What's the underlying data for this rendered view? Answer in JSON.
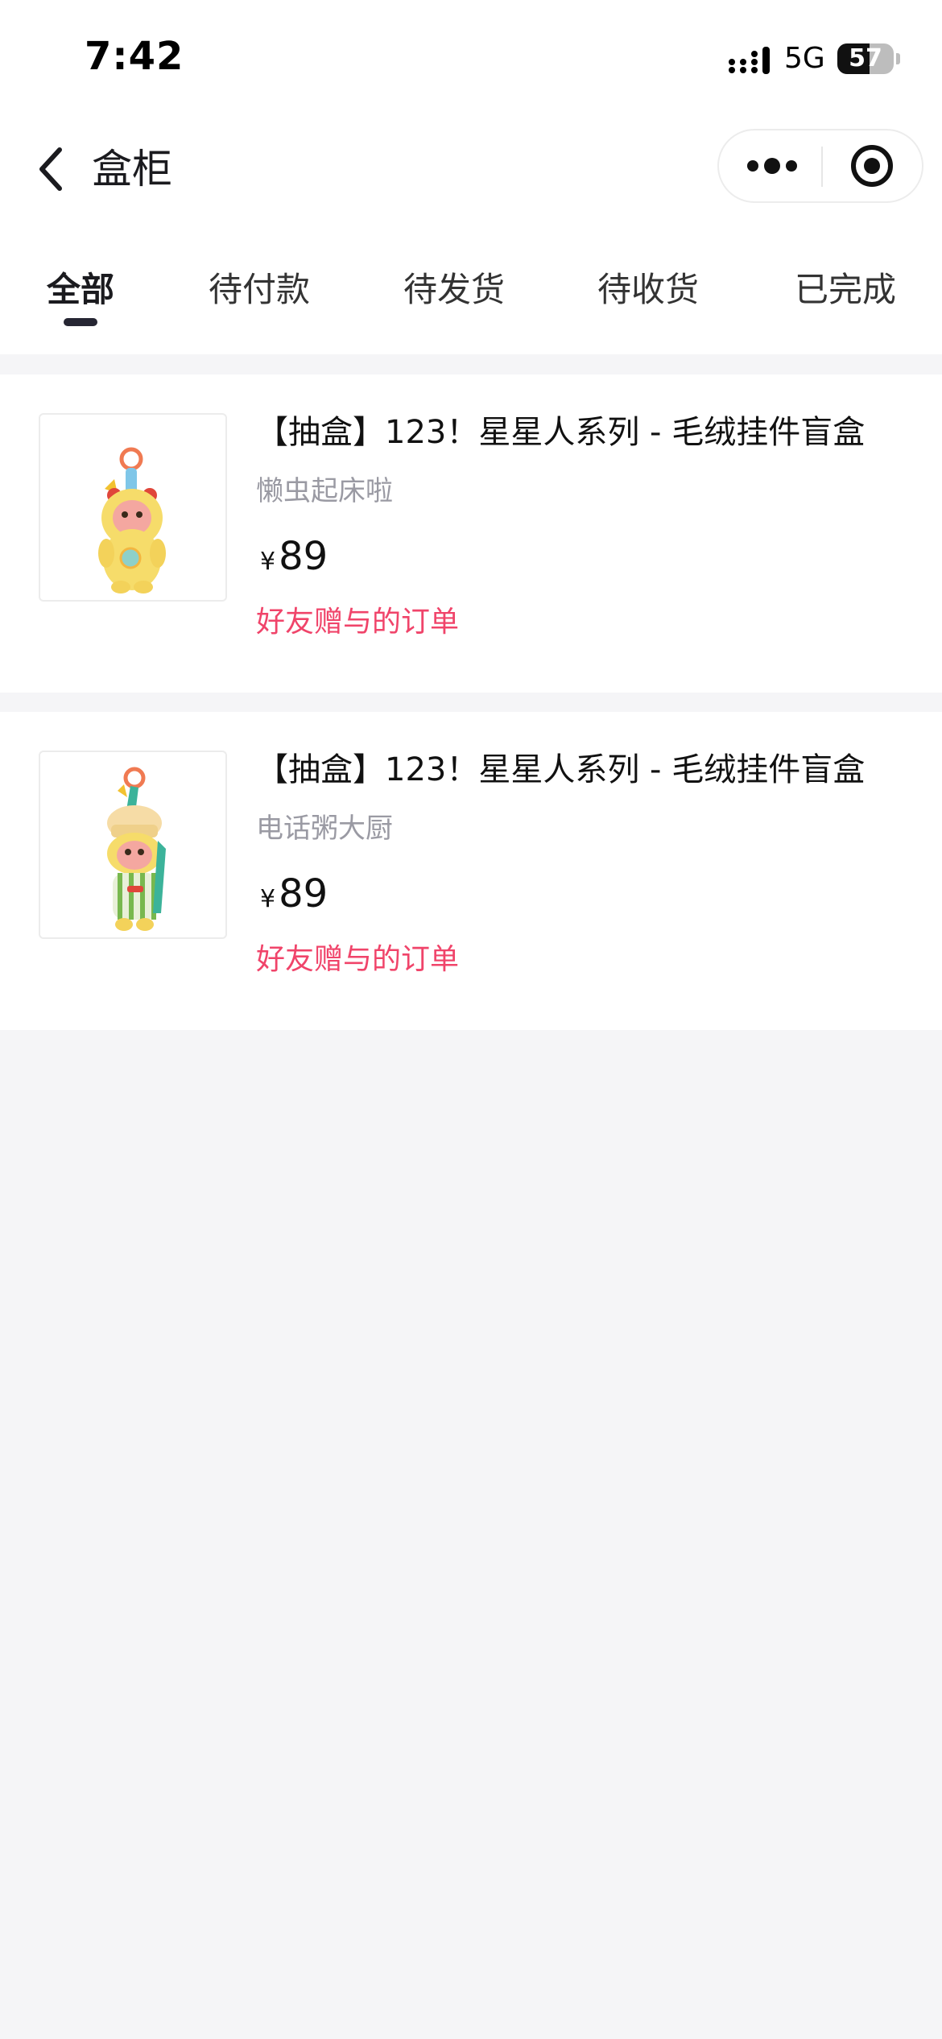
{
  "status_bar": {
    "time": "7:42",
    "network": "5G",
    "battery": "57",
    "battery_level_percent": 57
  },
  "header": {
    "title": "盒柜",
    "back_icon": "chevron-left-icon",
    "more_icon": "more-dots-icon",
    "close_icon": "target-circle-icon"
  },
  "tabs": [
    {
      "label": "全部",
      "active": true
    },
    {
      "label": "待付款",
      "active": false
    },
    {
      "label": "待发货",
      "active": false
    },
    {
      "label": "待收货",
      "active": false
    },
    {
      "label": "已完成",
      "active": false
    }
  ],
  "orders": [
    {
      "title": "【抽盒】123！星星人系列 - 毛绒挂件盲盒",
      "variant": "懒虫起床啦",
      "currency": "¥",
      "price": "89",
      "note": "好友赠与的订单"
    },
    {
      "title": "【抽盒】123！星星人系列 - 毛绒挂件盲盒",
      "variant": "电话粥大厨",
      "currency": "¥",
      "price": "89",
      "note": "好友赠与的订单"
    }
  ],
  "colors": {
    "accent_note": "#f0446a",
    "tab_indicator": "#262633",
    "page_bg": "#f5f5f7",
    "muted_text": "#9a9aa3"
  }
}
